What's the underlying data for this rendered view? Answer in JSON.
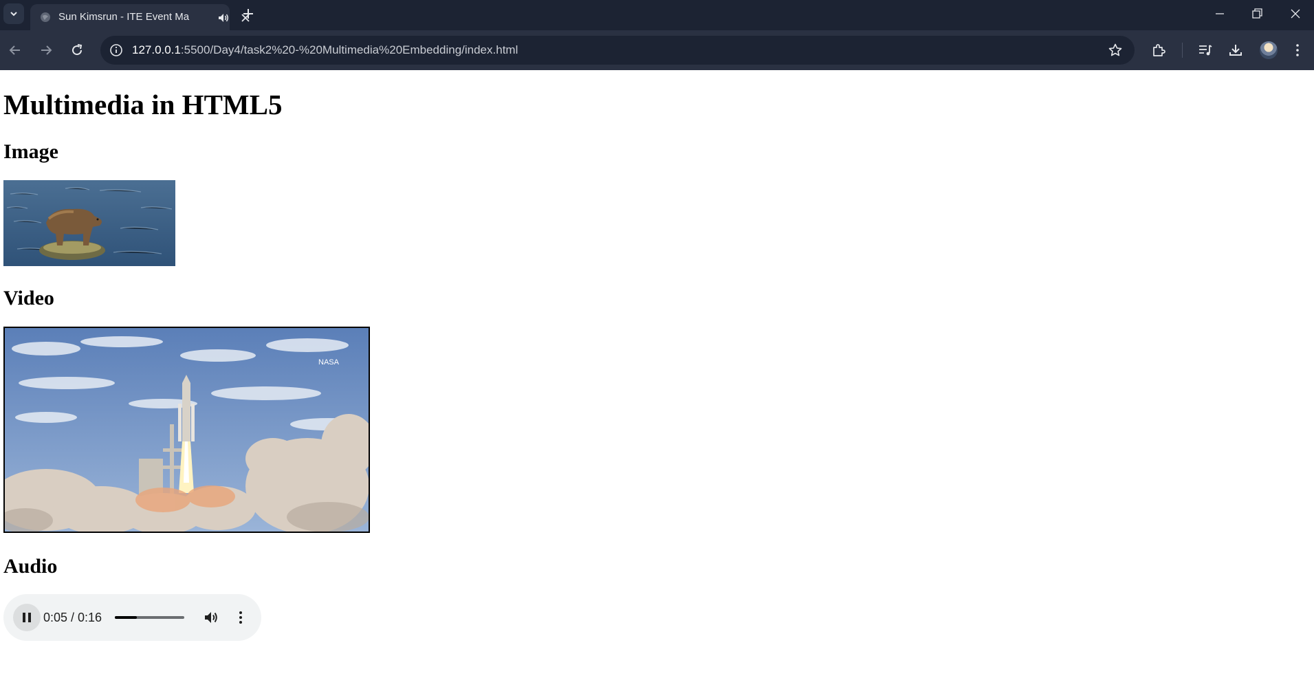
{
  "browser": {
    "tab": {
      "title": "Sun Kimsrun - ITE Event Ma",
      "audio_icon": "speaker-icon",
      "close_icon": "close-icon"
    },
    "new_tab_icon": "plus-icon",
    "address": {
      "host": "127.0.0.1",
      "path": ":5500/Day4/task2%20-%20Multimedia%20Embedding/index.html"
    }
  },
  "page": {
    "title": "Multimedia in HTML5",
    "image_heading": "Image",
    "video_heading": "Video",
    "audio_heading": "Audio",
    "video_watermark": "NASA"
  },
  "audio": {
    "state": "playing",
    "time_display": "0:05 / 0:16",
    "progress": 0.3125
  },
  "colors": {
    "tabstrip": "#1c2333",
    "toolbar": "#2a3142",
    "audio_bg": "#f1f3f4"
  }
}
